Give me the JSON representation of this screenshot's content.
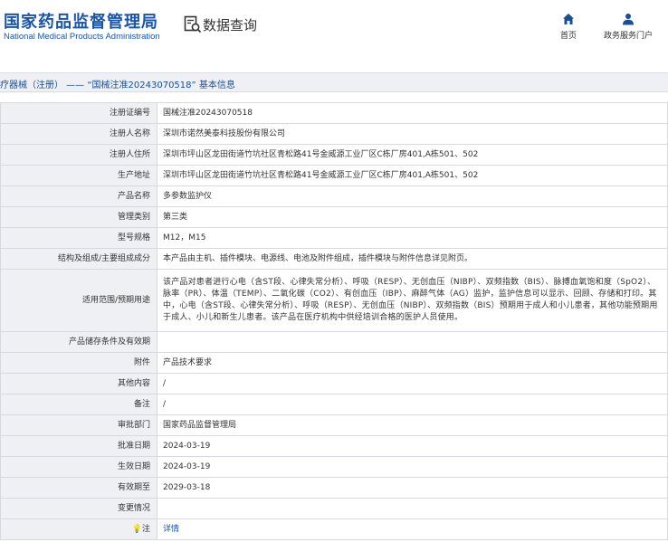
{
  "header": {
    "logo_cn": "国家药品监督管理局",
    "logo_en": "National Medical Products Administration",
    "section_title": "数据查询",
    "nav": [
      {
        "label": "首页",
        "icon": "home-icon"
      },
      {
        "label": "政务服务门户",
        "icon": "user-icon"
      }
    ]
  },
  "title_bar": "疗器械（注册） —— “国械注准20243070518” 基本信息",
  "rows": [
    {
      "key": "注册证编号",
      "value": "国械注准20243070518"
    },
    {
      "key": "注册人名称",
      "value": "深圳市诺然美泰科技股份有限公司"
    },
    {
      "key": "注册人住所",
      "value": "深圳市坪山区龙田街道竹坑社区青松路41号金威源工业厂区C栋厂房401,A栋501、502"
    },
    {
      "key": "生产地址",
      "value": "深圳市坪山区龙田街道竹坑社区青松路41号金威源工业厂区C栋厂房401,A栋501、502"
    },
    {
      "key": "产品名称",
      "value": "多参数监护仪"
    },
    {
      "key": "管理类别",
      "value": "第三类"
    },
    {
      "key": "型号规格",
      "value": "M12，M15"
    },
    {
      "key": "结构及组成/主要组成成分",
      "value": "本产品由主机、插件模块、电源线、电池及附件组成，插件模块与附件信息详见附页。"
    },
    {
      "key": "适用范围/预期用途",
      "value": "该产品对患者进行心电（含ST段、心律失常分析）、呼吸（RESP）、无创血压（NIBP）、双频指数（BIS）、脉搏血氧饱和度（SpO2）、脉率（PR）、体温（TEMP）、二氧化碳（CO2）、有创血压（IBP）、麻醉气体（AG）监护，监护信息可以显示、回顾、存储和打印。其中，心电（含ST段、心律失常分析）、呼吸（RESP）、无创血压（NIBP）、双频指数（BIS）预期用于成人和小儿患者，其他功能预期用于成人、小儿和新生儿患者。该产品在医疗机构中供经培训合格的医护人员使用。"
    },
    {
      "key": "产品储存条件及有效期",
      "value": ""
    },
    {
      "key": "附件",
      "value": "产品技术要求"
    },
    {
      "key": "其他内容",
      "value": "/"
    },
    {
      "key": "备注",
      "value": "/"
    },
    {
      "key": "审批部门",
      "value": "国家药品监督管理局"
    },
    {
      "key": "批准日期",
      "value": "2024-03-19"
    },
    {
      "key": "生效日期",
      "value": "2024-03-19"
    },
    {
      "key": "有效期至",
      "value": "2029-03-18"
    },
    {
      "key": "变更情况",
      "value": ""
    },
    {
      "key": "注",
      "value": "详情"
    }
  ]
}
